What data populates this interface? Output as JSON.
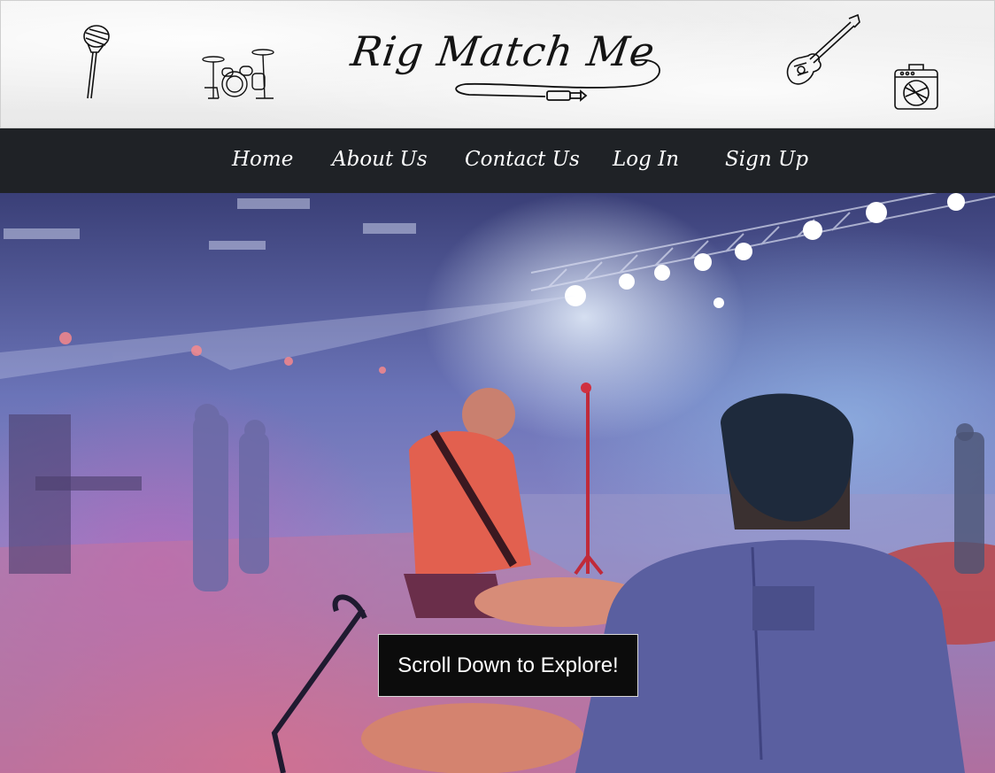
{
  "brand": {
    "logo_text": "Rig Match Me"
  },
  "nav": {
    "items": [
      {
        "label": "Home"
      },
      {
        "label": "About Us"
      },
      {
        "label": "Contact Us"
      },
      {
        "label": "Log In"
      },
      {
        "label": "Sign Up"
      }
    ]
  },
  "hero": {
    "cta_label": "Scroll Down to Explore!"
  },
  "colors": {
    "nav_bg": "#1f2226",
    "cta_bg": "#0c0c0c",
    "cta_text": "#ffffff",
    "nav_text": "#ffffff"
  },
  "icons": [
    "microphone-icon",
    "drum-kit-icon",
    "cable-icon",
    "guitar-icon",
    "amplifier-icon"
  ]
}
